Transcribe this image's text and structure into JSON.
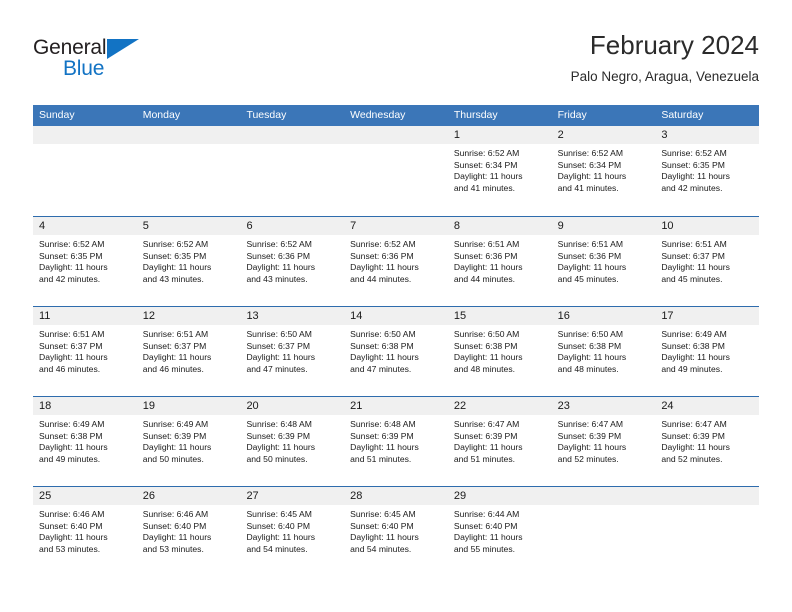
{
  "brand": {
    "name_part1": "General",
    "name_part2": "Blue",
    "triangle_color": "#1273c4"
  },
  "header": {
    "title": "February 2024",
    "subtitle": "Palo Negro, Aragua, Venezuela"
  },
  "theme": {
    "header_blue": "#3b76b8",
    "row_divider_blue": "#2e6cad",
    "day_band_gray": "#f0f0f0"
  },
  "weekdays": [
    "Sunday",
    "Monday",
    "Tuesday",
    "Wednesday",
    "Thursday",
    "Friday",
    "Saturday"
  ],
  "weeks": [
    [
      {
        "day": "",
        "sunrise": "",
        "sunset": "",
        "daylight1": "",
        "daylight2": ""
      },
      {
        "day": "",
        "sunrise": "",
        "sunset": "",
        "daylight1": "",
        "daylight2": ""
      },
      {
        "day": "",
        "sunrise": "",
        "sunset": "",
        "daylight1": "",
        "daylight2": ""
      },
      {
        "day": "",
        "sunrise": "",
        "sunset": "",
        "daylight1": "",
        "daylight2": ""
      },
      {
        "day": "1",
        "sunrise": "Sunrise: 6:52 AM",
        "sunset": "Sunset: 6:34 PM",
        "daylight1": "Daylight: 11 hours",
        "daylight2": "and 41 minutes."
      },
      {
        "day": "2",
        "sunrise": "Sunrise: 6:52 AM",
        "sunset": "Sunset: 6:34 PM",
        "daylight1": "Daylight: 11 hours",
        "daylight2": "and 41 minutes."
      },
      {
        "day": "3",
        "sunrise": "Sunrise: 6:52 AM",
        "sunset": "Sunset: 6:35 PM",
        "daylight1": "Daylight: 11 hours",
        "daylight2": "and 42 minutes."
      }
    ],
    [
      {
        "day": "4",
        "sunrise": "Sunrise: 6:52 AM",
        "sunset": "Sunset: 6:35 PM",
        "daylight1": "Daylight: 11 hours",
        "daylight2": "and 42 minutes."
      },
      {
        "day": "5",
        "sunrise": "Sunrise: 6:52 AM",
        "sunset": "Sunset: 6:35 PM",
        "daylight1": "Daylight: 11 hours",
        "daylight2": "and 43 minutes."
      },
      {
        "day": "6",
        "sunrise": "Sunrise: 6:52 AM",
        "sunset": "Sunset: 6:36 PM",
        "daylight1": "Daylight: 11 hours",
        "daylight2": "and 43 minutes."
      },
      {
        "day": "7",
        "sunrise": "Sunrise: 6:52 AM",
        "sunset": "Sunset: 6:36 PM",
        "daylight1": "Daylight: 11 hours",
        "daylight2": "and 44 minutes."
      },
      {
        "day": "8",
        "sunrise": "Sunrise: 6:51 AM",
        "sunset": "Sunset: 6:36 PM",
        "daylight1": "Daylight: 11 hours",
        "daylight2": "and 44 minutes."
      },
      {
        "day": "9",
        "sunrise": "Sunrise: 6:51 AM",
        "sunset": "Sunset: 6:36 PM",
        "daylight1": "Daylight: 11 hours",
        "daylight2": "and 45 minutes."
      },
      {
        "day": "10",
        "sunrise": "Sunrise: 6:51 AM",
        "sunset": "Sunset: 6:37 PM",
        "daylight1": "Daylight: 11 hours",
        "daylight2": "and 45 minutes."
      }
    ],
    [
      {
        "day": "11",
        "sunrise": "Sunrise: 6:51 AM",
        "sunset": "Sunset: 6:37 PM",
        "daylight1": "Daylight: 11 hours",
        "daylight2": "and 46 minutes."
      },
      {
        "day": "12",
        "sunrise": "Sunrise: 6:51 AM",
        "sunset": "Sunset: 6:37 PM",
        "daylight1": "Daylight: 11 hours",
        "daylight2": "and 46 minutes."
      },
      {
        "day": "13",
        "sunrise": "Sunrise: 6:50 AM",
        "sunset": "Sunset: 6:37 PM",
        "daylight1": "Daylight: 11 hours",
        "daylight2": "and 47 minutes."
      },
      {
        "day": "14",
        "sunrise": "Sunrise: 6:50 AM",
        "sunset": "Sunset: 6:38 PM",
        "daylight1": "Daylight: 11 hours",
        "daylight2": "and 47 minutes."
      },
      {
        "day": "15",
        "sunrise": "Sunrise: 6:50 AM",
        "sunset": "Sunset: 6:38 PM",
        "daylight1": "Daylight: 11 hours",
        "daylight2": "and 48 minutes."
      },
      {
        "day": "16",
        "sunrise": "Sunrise: 6:50 AM",
        "sunset": "Sunset: 6:38 PM",
        "daylight1": "Daylight: 11 hours",
        "daylight2": "and 48 minutes."
      },
      {
        "day": "17",
        "sunrise": "Sunrise: 6:49 AM",
        "sunset": "Sunset: 6:38 PM",
        "daylight1": "Daylight: 11 hours",
        "daylight2": "and 49 minutes."
      }
    ],
    [
      {
        "day": "18",
        "sunrise": "Sunrise: 6:49 AM",
        "sunset": "Sunset: 6:38 PM",
        "daylight1": "Daylight: 11 hours",
        "daylight2": "and 49 minutes."
      },
      {
        "day": "19",
        "sunrise": "Sunrise: 6:49 AM",
        "sunset": "Sunset: 6:39 PM",
        "daylight1": "Daylight: 11 hours",
        "daylight2": "and 50 minutes."
      },
      {
        "day": "20",
        "sunrise": "Sunrise: 6:48 AM",
        "sunset": "Sunset: 6:39 PM",
        "daylight1": "Daylight: 11 hours",
        "daylight2": "and 50 minutes."
      },
      {
        "day": "21",
        "sunrise": "Sunrise: 6:48 AM",
        "sunset": "Sunset: 6:39 PM",
        "daylight1": "Daylight: 11 hours",
        "daylight2": "and 51 minutes."
      },
      {
        "day": "22",
        "sunrise": "Sunrise: 6:47 AM",
        "sunset": "Sunset: 6:39 PM",
        "daylight1": "Daylight: 11 hours",
        "daylight2": "and 51 minutes."
      },
      {
        "day": "23",
        "sunrise": "Sunrise: 6:47 AM",
        "sunset": "Sunset: 6:39 PM",
        "daylight1": "Daylight: 11 hours",
        "daylight2": "and 52 minutes."
      },
      {
        "day": "24",
        "sunrise": "Sunrise: 6:47 AM",
        "sunset": "Sunset: 6:39 PM",
        "daylight1": "Daylight: 11 hours",
        "daylight2": "and 52 minutes."
      }
    ],
    [
      {
        "day": "25",
        "sunrise": "Sunrise: 6:46 AM",
        "sunset": "Sunset: 6:40 PM",
        "daylight1": "Daylight: 11 hours",
        "daylight2": "and 53 minutes."
      },
      {
        "day": "26",
        "sunrise": "Sunrise: 6:46 AM",
        "sunset": "Sunset: 6:40 PM",
        "daylight1": "Daylight: 11 hours",
        "daylight2": "and 53 minutes."
      },
      {
        "day": "27",
        "sunrise": "Sunrise: 6:45 AM",
        "sunset": "Sunset: 6:40 PM",
        "daylight1": "Daylight: 11 hours",
        "daylight2": "and 54 minutes."
      },
      {
        "day": "28",
        "sunrise": "Sunrise: 6:45 AM",
        "sunset": "Sunset: 6:40 PM",
        "daylight1": "Daylight: 11 hours",
        "daylight2": "and 54 minutes."
      },
      {
        "day": "29",
        "sunrise": "Sunrise: 6:44 AM",
        "sunset": "Sunset: 6:40 PM",
        "daylight1": "Daylight: 11 hours",
        "daylight2": "and 55 minutes."
      },
      {
        "day": "",
        "sunrise": "",
        "sunset": "",
        "daylight1": "",
        "daylight2": ""
      },
      {
        "day": "",
        "sunrise": "",
        "sunset": "",
        "daylight1": "",
        "daylight2": ""
      }
    ]
  ]
}
